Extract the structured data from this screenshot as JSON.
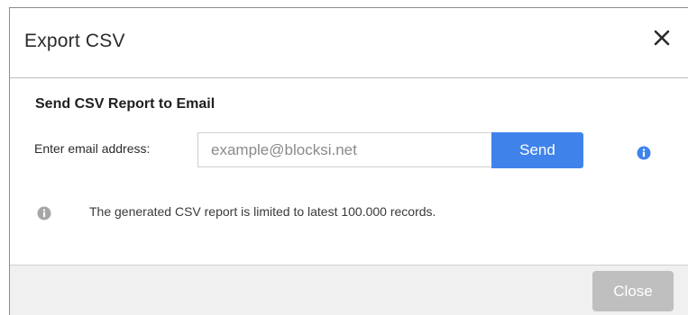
{
  "dialog": {
    "title": "Export CSV",
    "close_icon": "close-x-icon"
  },
  "section": {
    "title": "Send CSV Report to Email"
  },
  "email": {
    "label": "Enter email address:",
    "placeholder": "example@blocksi.net",
    "value": "",
    "send_label": "Send",
    "help_icon": "info-icon"
  },
  "notice": {
    "icon": "info-icon",
    "text": "The generated CSV report is limited to latest 100.000 records."
  },
  "footer": {
    "close_label": "Close"
  },
  "colors": {
    "accent": "#3f83ea",
    "disabled_button": "#bfbfbf",
    "info_gray": "#a6a6a6",
    "footer_bg": "#f0f0f0"
  }
}
